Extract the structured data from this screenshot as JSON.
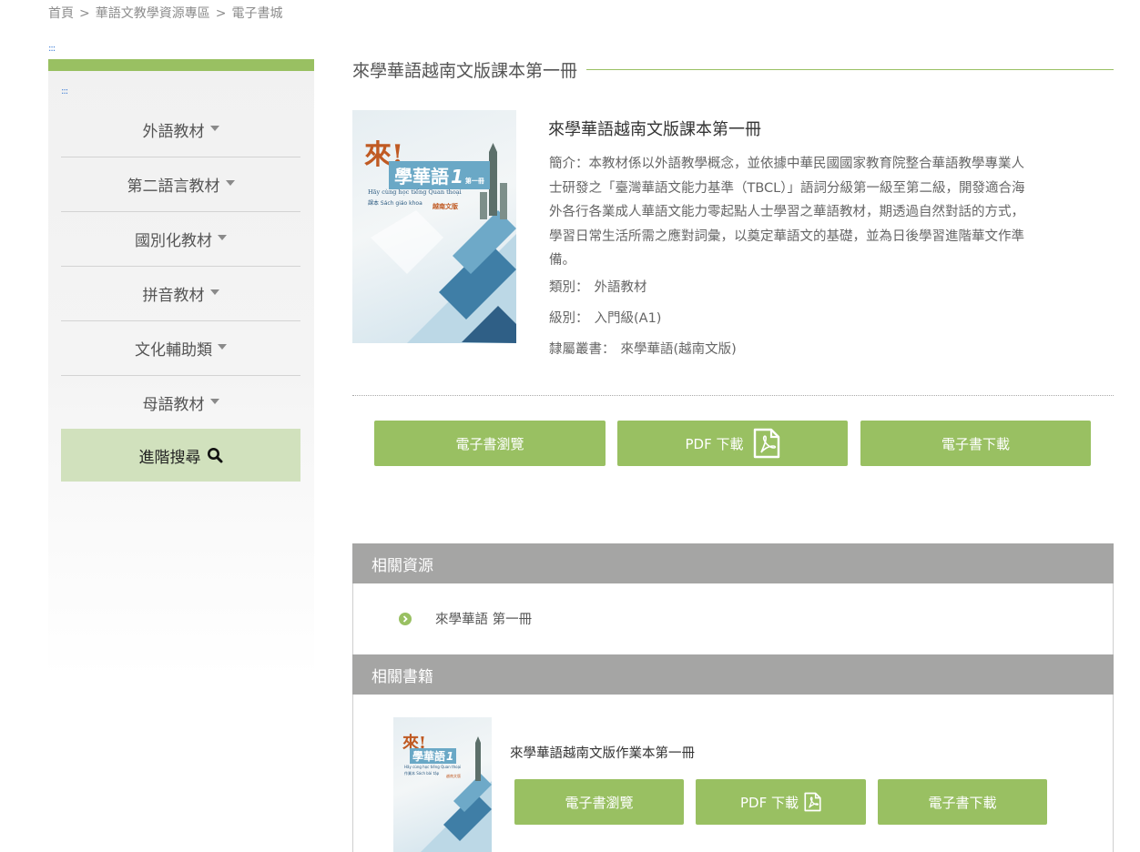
{
  "breadcrumb": {
    "items": [
      "首頁",
      "華語文教學資源專區",
      "電子書城"
    ],
    "separator": ">"
  },
  "anchor_marker": ":::",
  "sidebar": {
    "items": [
      {
        "label": "外語教材"
      },
      {
        "label": "第二語言教材"
      },
      {
        "label": "國別化教材"
      },
      {
        "label": "拼音教材"
      },
      {
        "label": "文化輔助類"
      },
      {
        "label": "母語教材"
      }
    ],
    "advanced_search": "進階搜尋"
  },
  "main": {
    "title": "來學華語越南文版課本第一冊",
    "book": {
      "title": "來學華語越南文版課本第一冊",
      "cover": {
        "brand": "來!",
        "series": "學華語",
        "number": "1",
        "volume": "第一冊",
        "subtitle": "Hãy cùng học tiếng Quan thoại",
        "book_type": "課本 Sách giáo khoa",
        "edition": "越南文版"
      },
      "description_label": "簡介：",
      "description": "本教材係以外語教學概念，並依據中華民國國家教育院整合華語教學專業人士研發之「臺灣華語文能力基準（TBCL）」語詞分級第一級至第二級，開發適合海外各行各業成人華語文能力零起點人士學習之華語教材，期透過自然對話的方式，學習日常生活所需之應對詞彙，以奠定華語文的基礎，並為日後學習進階華文作準備。",
      "category_label": "類別：",
      "category": "外語教材",
      "level_label": "級別：",
      "level": "入門級(A1)",
      "series_label": "隸屬叢書：",
      "series": "來學華語(越南文版)"
    },
    "buttons": {
      "browse": "電子書瀏覽",
      "pdf": "PDF 下載",
      "download": "電子書下載"
    }
  },
  "related_resources": {
    "header": "相關資源",
    "items": [
      {
        "label": "來學華語 第一冊"
      }
    ]
  },
  "related_books": {
    "header": "相關書籍",
    "items": [
      {
        "title": "來學華語越南文版作業本第一冊",
        "cover": {
          "brand": "來!",
          "series": "學華語",
          "number": "1",
          "subtitle": "Hãy cùng học tiếng Quan thoại",
          "book_type": "作業本 Sách bài tập",
          "edition": "越南文版"
        },
        "buttons": {
          "browse": "電子書瀏覽",
          "pdf": "PDF 下載",
          "download": "電子書下載"
        }
      }
    ]
  },
  "colors": {
    "accent": "#99c062",
    "panel_header": "#a5a5a4",
    "search_bg": "#d1e1bd",
    "cover_brand": "#c05a23",
    "cover_title_bg": "#6aa8c6"
  }
}
